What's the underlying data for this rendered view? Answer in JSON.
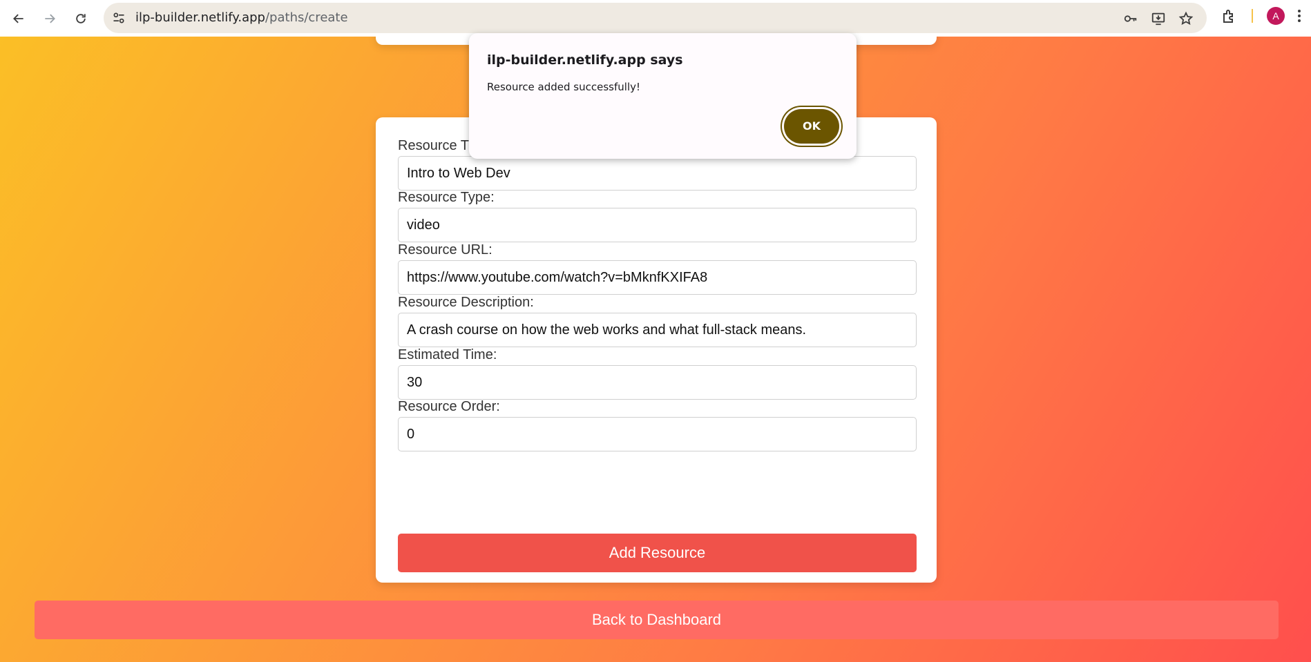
{
  "browser": {
    "url_host": "ilp-builder.netlify.app",
    "url_path": "/paths/create",
    "profile_initial": "A"
  },
  "dialog": {
    "title": "ilp-builder.netlify.app says",
    "message": "Resource added successfully!",
    "ok_label": "OK"
  },
  "form": {
    "fields": [
      {
        "label": "Resource Title:",
        "value": "Intro to Web Dev"
      },
      {
        "label": "Resource Type:",
        "value": "video"
      },
      {
        "label": "Resource URL:",
        "value": "https://www.youtube.com/watch?v=bMknfKXIFA8"
      },
      {
        "label": "Resource Description:",
        "value": "A crash course on how the web works and what full-stack means."
      },
      {
        "label": "Estimated Time:",
        "value": "30"
      },
      {
        "label": "Resource Order:",
        "value": "0"
      }
    ],
    "submit_label": "Add Resource"
  },
  "back_label": "Back to Dashboard",
  "colors": {
    "add_button": "#f0524a",
    "back_button": "#ff6b63",
    "dialog_ok": "#6b5500",
    "avatar": "#c2185b"
  }
}
